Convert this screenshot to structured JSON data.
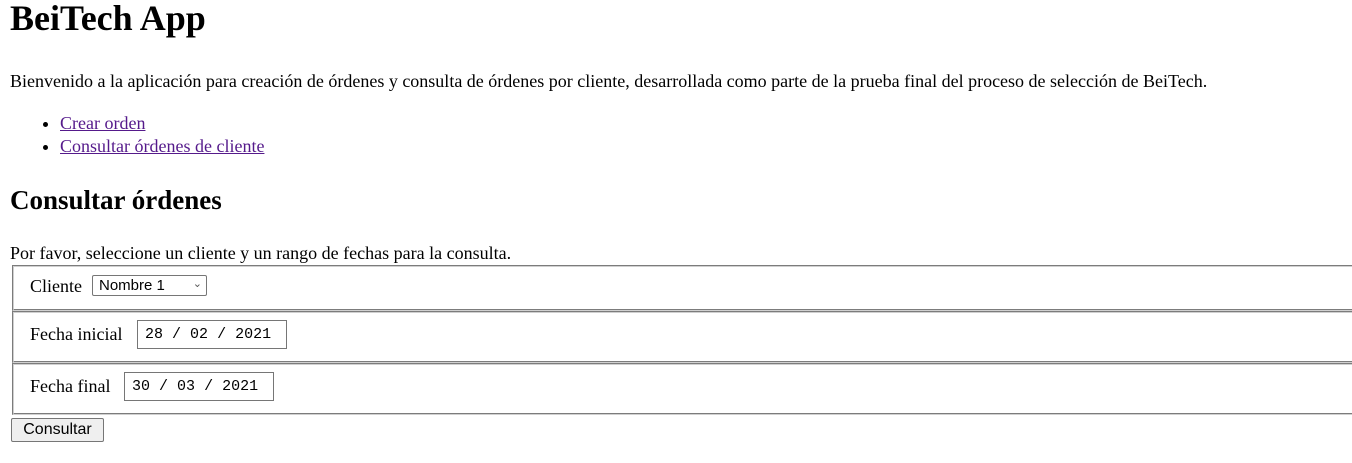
{
  "header": {
    "title": "BeiTech App",
    "intro": "Bienvenido a la aplicación para creación de órdenes y consulta de órdenes por cliente, desarrollada como parte de la prueba final del proceso de selección de BeiTech."
  },
  "nav": {
    "items": [
      {
        "label": "Crear orden"
      },
      {
        "label": "Consultar órdenes de cliente"
      }
    ]
  },
  "section": {
    "title": "Consultar órdenes",
    "help": "Por favor, seleccione un cliente y un rango de fechas para la consulta."
  },
  "form": {
    "cliente": {
      "label": "Cliente",
      "selected": "Nombre 1"
    },
    "fecha_inicial": {
      "label": "Fecha inicial",
      "day": "28",
      "month": "02",
      "year": "2021"
    },
    "fecha_final": {
      "label": "Fecha final",
      "day": "30",
      "month": "03",
      "year": "2021"
    },
    "submit_label": "Consultar"
  },
  "colors": {
    "link_visited": "#551a8b",
    "button_bg": "#efefef",
    "border": "#767676"
  },
  "icons": {
    "select_arrow": "chevron-down-icon"
  }
}
